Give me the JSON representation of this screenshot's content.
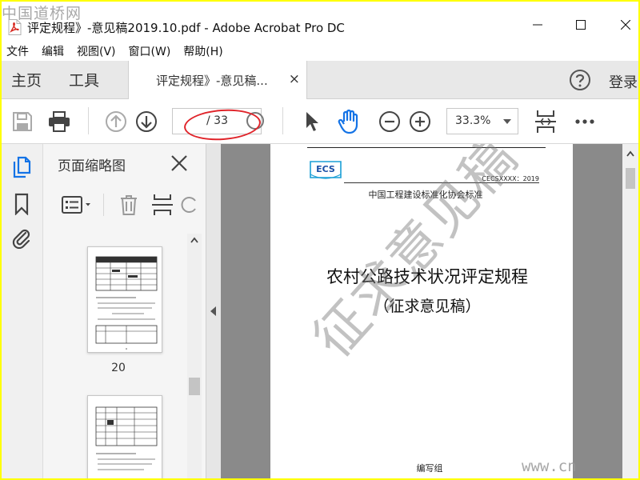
{
  "overlay": {
    "watermark_top": "中国道桥网",
    "watermark_bottom": "www.cn",
    "annotation_color": "#e0242a"
  },
  "window": {
    "title": "评定规程》-意见稿2019.10.pdf - Adobe Acrobat Pro DC",
    "controls": [
      "minimize-icon",
      "maximize-icon",
      "close-icon"
    ]
  },
  "menu": {
    "items": [
      "文件",
      "编辑",
      "视图(V)",
      "窗口(W)",
      "帮助(H)"
    ]
  },
  "nav": {
    "home": "主页",
    "tools": "工具",
    "doc_tab": "评定规程》-意见稿...",
    "doc_tab_close": "×",
    "login": "登录"
  },
  "toolbar": {
    "icons": [
      "save-icon",
      "print-icon",
      "page-up-icon",
      "page-down-icon",
      "select-arrow-icon",
      "hand-icon",
      "zoom-out-icon",
      "zoom-in-icon",
      "fit-page-icon",
      "more-icon"
    ],
    "page_current": "",
    "page_total": "/ 33",
    "zoom": "33.3%"
  },
  "sidebar": {
    "panel_title": "页面缩略图",
    "thumbnail_label": "20",
    "icons": [
      "page-thumbnails-icon",
      "bookmark-icon",
      "attachment-icon"
    ]
  },
  "document": {
    "logo": "ECS",
    "code": "CECSXXXX：2019",
    "organization": "中国工程建设标准化协会标准",
    "title": "农村公路技术状况评定规程",
    "subtitle": "（征求意见稿）",
    "watermark": "征求意见稿",
    "editor": "编写组"
  }
}
